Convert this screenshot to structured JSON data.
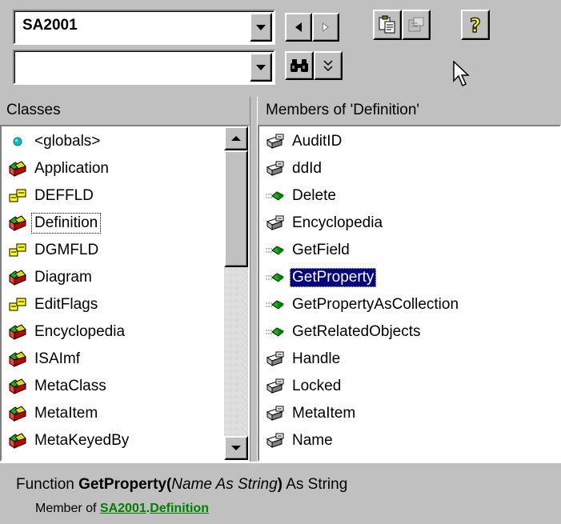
{
  "toolbar": {
    "library_value": "SA2001",
    "search_value": "",
    "icons": {
      "back": "triangle-left-icon",
      "forward": "triangle-right-icon",
      "copy": "copy-clipboard-icon",
      "view_definition": "view-definition-icon",
      "help": "question-mark-icon",
      "search": "binoculars-icon",
      "show_hide_results": "double-chevron-down-icon"
    }
  },
  "classes_panel": {
    "header": "Classes",
    "items": [
      {
        "label": "<globals>",
        "icon": "globe-dot-icon"
      },
      {
        "label": "Application",
        "icon": "class-icon"
      },
      {
        "label": "DEFFLD",
        "icon": "enum-icon"
      },
      {
        "label": "Definition",
        "icon": "class-icon"
      },
      {
        "label": "DGMFLD",
        "icon": "enum-icon"
      },
      {
        "label": "Diagram",
        "icon": "class-icon"
      },
      {
        "label": "EditFlags",
        "icon": "enum-icon"
      },
      {
        "label": "Encyclopedia",
        "icon": "class-icon"
      },
      {
        "label": "ISAImf",
        "icon": "class-icon"
      },
      {
        "label": "MetaClass",
        "icon": "class-icon"
      },
      {
        "label": "MetaItem",
        "icon": "class-icon"
      },
      {
        "label": "MetaKeyedBy",
        "icon": "class-icon"
      }
    ],
    "focused_index": 3
  },
  "members_panel": {
    "header": "Members of 'Definition'",
    "items": [
      {
        "label": "AuditID",
        "icon": "property-icon"
      },
      {
        "label": "ddId",
        "icon": "property-icon"
      },
      {
        "label": "Delete",
        "icon": "method-icon"
      },
      {
        "label": "Encyclopedia",
        "icon": "property-icon"
      },
      {
        "label": "GetField",
        "icon": "method-icon"
      },
      {
        "label": "GetProperty",
        "icon": "method-icon"
      },
      {
        "label": "GetPropertyAsCollection",
        "icon": "method-icon"
      },
      {
        "label": "GetRelatedObjects",
        "icon": "method-icon"
      },
      {
        "label": "Handle",
        "icon": "property-icon"
      },
      {
        "label": "Locked",
        "icon": "property-icon"
      },
      {
        "label": "MetaItem",
        "icon": "property-icon"
      },
      {
        "label": "Name",
        "icon": "property-icon"
      }
    ],
    "selected_index": 5
  },
  "details": {
    "prefix": "Function ",
    "name": "GetProperty(",
    "params": "Name As String",
    "close": ")",
    "suffix": " As String",
    "member_of": "Member of ",
    "library_link": "SA2001",
    "dot": ".",
    "class_link": "Definition"
  },
  "colors": {
    "selection": "#000080",
    "link": "#008000",
    "face": "#c0c0c0"
  }
}
